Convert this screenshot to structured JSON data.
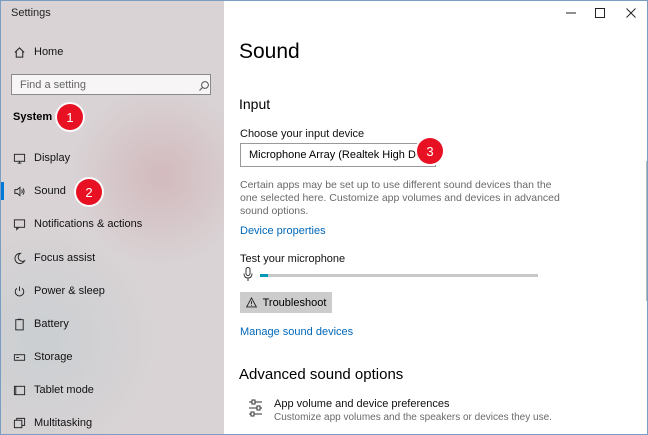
{
  "app": {
    "title": "Settings"
  },
  "sidebar": {
    "home_label": "Home",
    "search_placeholder": "Find a setting",
    "section_title": "System",
    "items": [
      {
        "label": "Display",
        "icon": "display-icon"
      },
      {
        "label": "Sound",
        "icon": "speaker-icon",
        "active": true
      },
      {
        "label": "Notifications & actions",
        "icon": "notifications-icon"
      },
      {
        "label": "Focus assist",
        "icon": "moon-icon"
      },
      {
        "label": "Power & sleep",
        "icon": "power-icon"
      },
      {
        "label": "Battery",
        "icon": "battery-icon"
      },
      {
        "label": "Storage",
        "icon": "storage-icon"
      },
      {
        "label": "Tablet mode",
        "icon": "tablet-icon"
      },
      {
        "label": "Multitasking",
        "icon": "multitasking-icon"
      }
    ]
  },
  "badges": [
    "1",
    "2",
    "3"
  ],
  "main": {
    "title": "Sound",
    "input_heading": "Input",
    "choose_label": "Choose your input device",
    "selected_device": "Microphone Array (Realtek High De...",
    "description": "Certain apps may be set up to use different sound devices than the one selected here. Customize app volumes and devices in advanced sound options.",
    "device_properties_link": "Device properties",
    "test_label": "Test your microphone",
    "mic_level": 0.03,
    "troubleshoot_label": "Troubleshoot",
    "manage_link": "Manage sound devices",
    "advanced_heading": "Advanced sound options",
    "advanced_option_title": "App volume and device preferences",
    "advanced_option_subtitle": "Customize app volumes and the speakers or devices they use."
  },
  "colors": {
    "accent": "#0078d7",
    "link": "#0067b8",
    "badge": "#e81123",
    "meter_fill": "#0099bc"
  }
}
